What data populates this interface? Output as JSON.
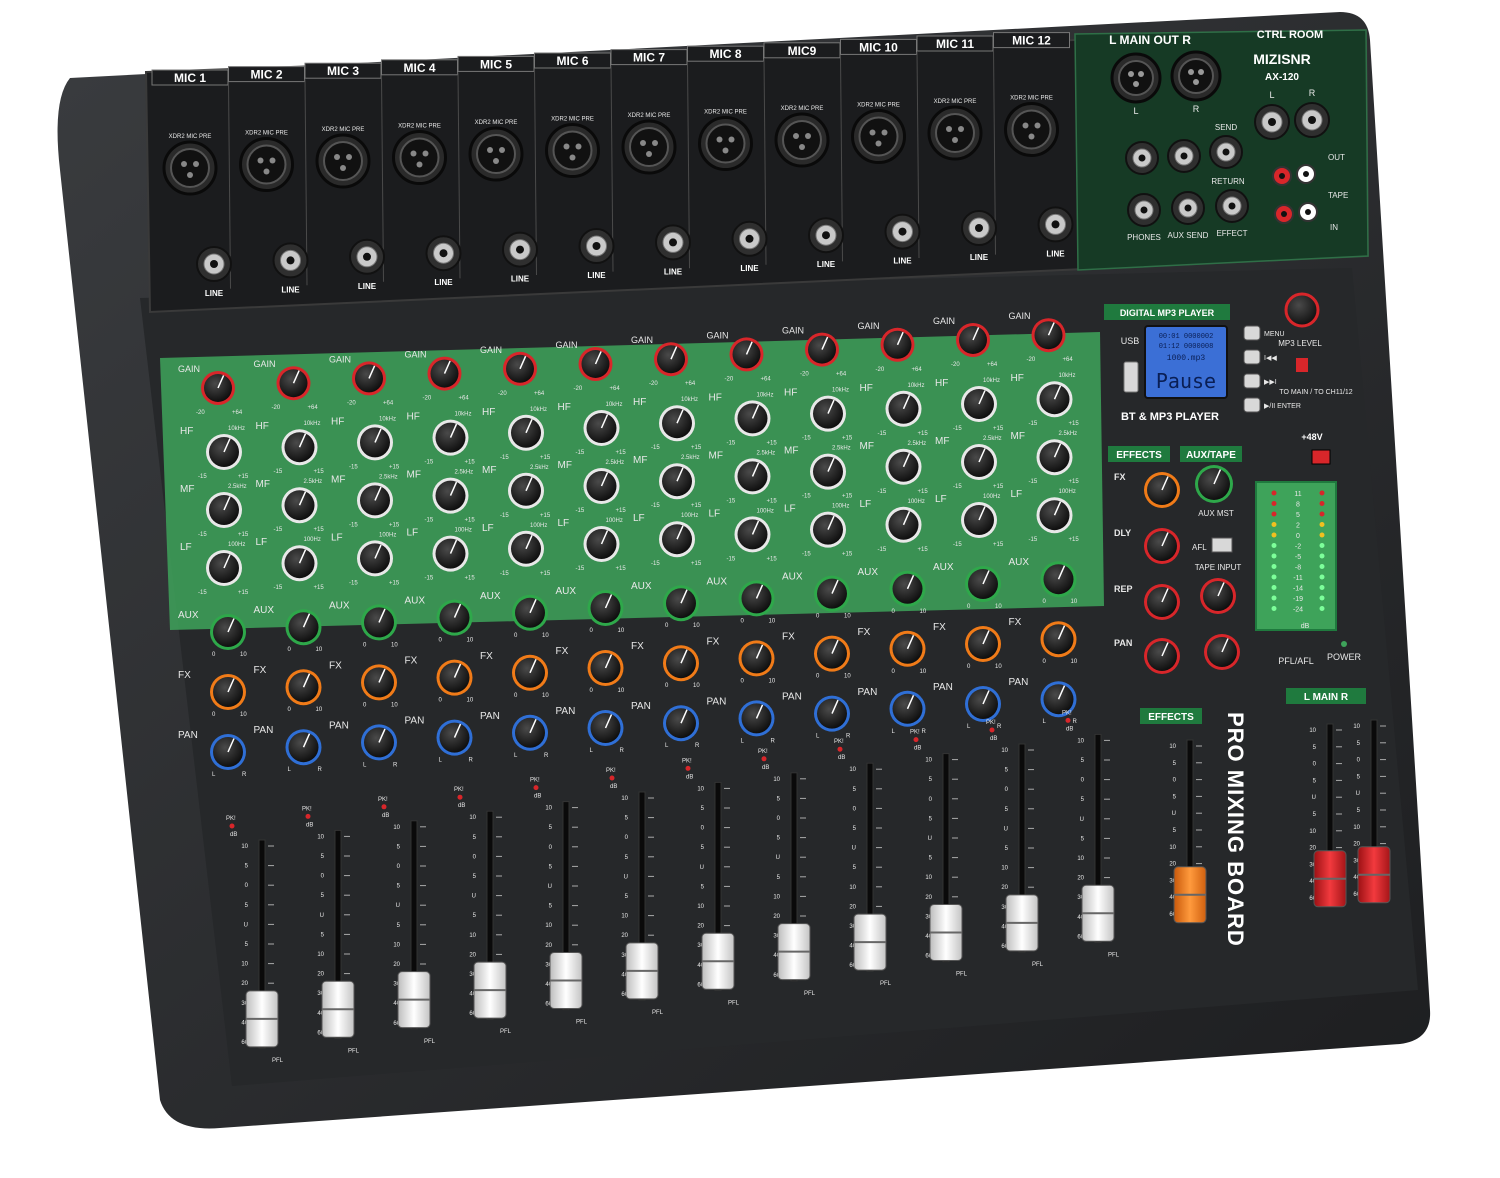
{
  "brand": {
    "name": "MIZISNR",
    "model": "AX-120",
    "panel_title": "PRO MIXING BOARD"
  },
  "channels": [
    {
      "name": "MIC 1"
    },
    {
      "name": "MIC 2"
    },
    {
      "name": "MIC 3"
    },
    {
      "name": "MIC 4"
    },
    {
      "name": "MIC 5"
    },
    {
      "name": "MIC 6"
    },
    {
      "name": "MIC 7"
    },
    {
      "name": "MIC 8"
    },
    {
      "name": "MIC9"
    },
    {
      "name": "MIC 10"
    },
    {
      "name": "MIC 11"
    },
    {
      "name": "MIC 12"
    }
  ],
  "input_labels": {
    "xlr": "XDR2 MIC PRE",
    "line": "LINE"
  },
  "channel_strip": {
    "gain": "GAIN",
    "gain_min": "-20",
    "gain_max": "+64",
    "hf": "HF",
    "mf": "MF",
    "lf": "LF",
    "hf_freq": "10kHz",
    "mf_freq": "2.5kHz",
    "lf_freq": "100Hz",
    "eq_min": "-15",
    "eq_max": "+15",
    "aux": "AUX",
    "fx": "FX",
    "pan": "PAN",
    "level_min": "0",
    "level_max": "10",
    "pan_l": "L",
    "pan_r": "R",
    "pk": "PK!",
    "db": "dB",
    "pfl": "PFL",
    "fader_scale": [
      "10",
      "5",
      "0",
      "5",
      "U",
      "5",
      "10",
      "20",
      "30",
      "40",
      "60"
    ]
  },
  "main_out": {
    "title": "L  MAIN OUT  R",
    "l": "L",
    "r": "R",
    "send": "SEND",
    "return": "RETURN",
    "phones": "PHONES",
    "aux_send": "AUX SEND",
    "effect": "EFFECT"
  },
  "ctrl_room": {
    "title": "CTRL ROOM",
    "l": "L",
    "r": "R",
    "out": "OUT",
    "tape": "TAPE",
    "in": "IN"
  },
  "mp3_player": {
    "title": "DIGITAL MP3 PLAYER",
    "usb": "USB",
    "lcd_line1": "00:01  0000002",
    "lcd_line2": "01:12  0000008",
    "lcd_file": "1000.mp3",
    "lcd_status": "Pause",
    "subtitle": "BT & MP3 PLAYER",
    "buttons": [
      "MENU",
      "I◀◀",
      "▶▶I",
      "▶/II ENTER"
    ],
    "level_label": "MP3 LEVEL",
    "route_label": "TO MAIN / TO CH11/12"
  },
  "effects_section": {
    "title": "EFFECTS",
    "fx": "FX",
    "dly": "DLY",
    "rep": "REP",
    "pan": "PAN"
  },
  "aux_tape": {
    "title": "AUX/TAPE",
    "aux_mst": "AUX MST",
    "afl": "AFL",
    "tape_input": "TAPE INPUT"
  },
  "phantom": "+48V",
  "meter": {
    "ticks": [
      "11",
      "8",
      "5",
      "2",
      "0",
      "-2",
      "-5",
      "-8",
      "-11",
      "-14",
      "-19",
      "-24"
    ],
    "unit": "dB",
    "pfl_afl": "PFL/AFL",
    "power": "POWER"
  },
  "effects_fader": {
    "title": "EFFECTS"
  },
  "main_fader": {
    "title": "L  MAIN  R"
  },
  "colors": {
    "body": "#2b2d2f",
    "panel_green": "#3ea35a",
    "accent_green": "#1f7a3e",
    "fader_white": "#e6e6e6",
    "fader_orange": "#f07b18",
    "fader_red": "#d8262a",
    "lcd": "#3b6fd6"
  }
}
